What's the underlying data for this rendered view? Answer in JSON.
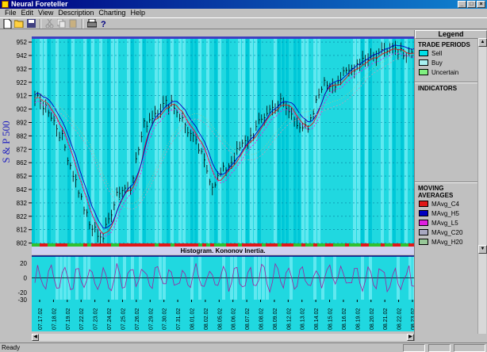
{
  "app": {
    "title": "Neural Foreteller",
    "status": "Ready"
  },
  "menu": [
    "File",
    "Edit",
    "View",
    "Description",
    "Charting",
    "Help"
  ],
  "chart": {
    "ylabel": "S & P 500",
    "histogram_title": "Histogram. Kononov Inertia."
  },
  "legend": {
    "title": "Legend",
    "trade_title": "TRADE PERIODS",
    "indicators_title": "INDICATORS",
    "ma_title": "MOVING AVERAGES"
  },
  "colors": {
    "sell": "#00e0e8",
    "buy": "#a8f0f0",
    "uncertain": "#80f080",
    "bg": "#20d8e0",
    "ma_c4": "#e01818",
    "ma_h5": "#0000c0",
    "ma_l5": "#e020e0",
    "ma_c20": "#a8a8c0",
    "ma_h20": "#98c898"
  },
  "chart_data": {
    "type": "line",
    "title": "",
    "ylabel": "S & P 500",
    "y_ticks": [
      952,
      942,
      932,
      922,
      912,
      902,
      892,
      882,
      872,
      862,
      852,
      842,
      832,
      822,
      812,
      802
    ],
    "ylim": [
      800,
      955
    ],
    "x_tick_labels": [
      "07.17.02",
      "07.18.02",
      "07.19.02",
      "07.22.02",
      "07.23.02",
      "07.24.02",
      "07.25.02",
      "07.26.02",
      "07.29.02",
      "07.30.02",
      "07.31.02",
      "08.01.02",
      "08.02.02",
      "08.05.02",
      "08.06.02",
      "08.07.02",
      "08.08.02",
      "08.09.02",
      "08.12.02",
      "08.13.02",
      "08.14.02",
      "08.15.02",
      "08.16.02",
      "08.19.02",
      "08.20.02",
      "08.21.02",
      "08.22.02",
      "08.23.02"
    ],
    "series": [
      {
        "name": "S & P 500",
        "x": [
          "07.17.02",
          "07.18.02",
          "07.19.02",
          "07.22.02",
          "07.23.02",
          "07.24.02",
          "07.25.02",
          "07.26.02",
          "07.29.02",
          "07.30.02",
          "07.31.02",
          "08.01.02",
          "08.02.02",
          "08.05.02",
          "08.06.02",
          "08.07.02",
          "08.08.02",
          "08.09.02",
          "08.12.02",
          "08.13.02",
          "08.14.02",
          "08.15.02",
          "08.16.02",
          "08.19.02",
          "08.20.02",
          "08.21.02",
          "08.22.02",
          "08.23.02"
        ],
        "values": [
          910,
          902,
          880,
          848,
          815,
          806,
          840,
          845,
          890,
          902,
          908,
          890,
          872,
          846,
          858,
          872,
          884,
          900,
          907,
          895,
          885,
          920,
          922,
          930,
          940,
          942,
          950,
          945
        ]
      }
    ],
    "histogram": {
      "title": "Histogram. Kononov Inertia.",
      "y_ticks": [
        20,
        0,
        -20,
        -30
      ],
      "ylim": [
        -30,
        30
      ]
    }
  },
  "legend_items": {
    "trade": [
      {
        "label": "Sell",
        "color": "#00e0e8"
      },
      {
        "label": "Buy",
        "color": "#a8f0f0"
      },
      {
        "label": "Uncertain",
        "color": "#80f080"
      }
    ],
    "ma": [
      {
        "label": "MAvg_C4",
        "color": "#e01818"
      },
      {
        "label": "MAvg_H5",
        "color": "#0000c0"
      },
      {
        "label": "MAvg_L5",
        "color": "#e020e0"
      },
      {
        "label": "MAvg_C20",
        "color": "#a8a8c0"
      },
      {
        "label": "MAvg_H20",
        "color": "#98c898"
      }
    ]
  }
}
